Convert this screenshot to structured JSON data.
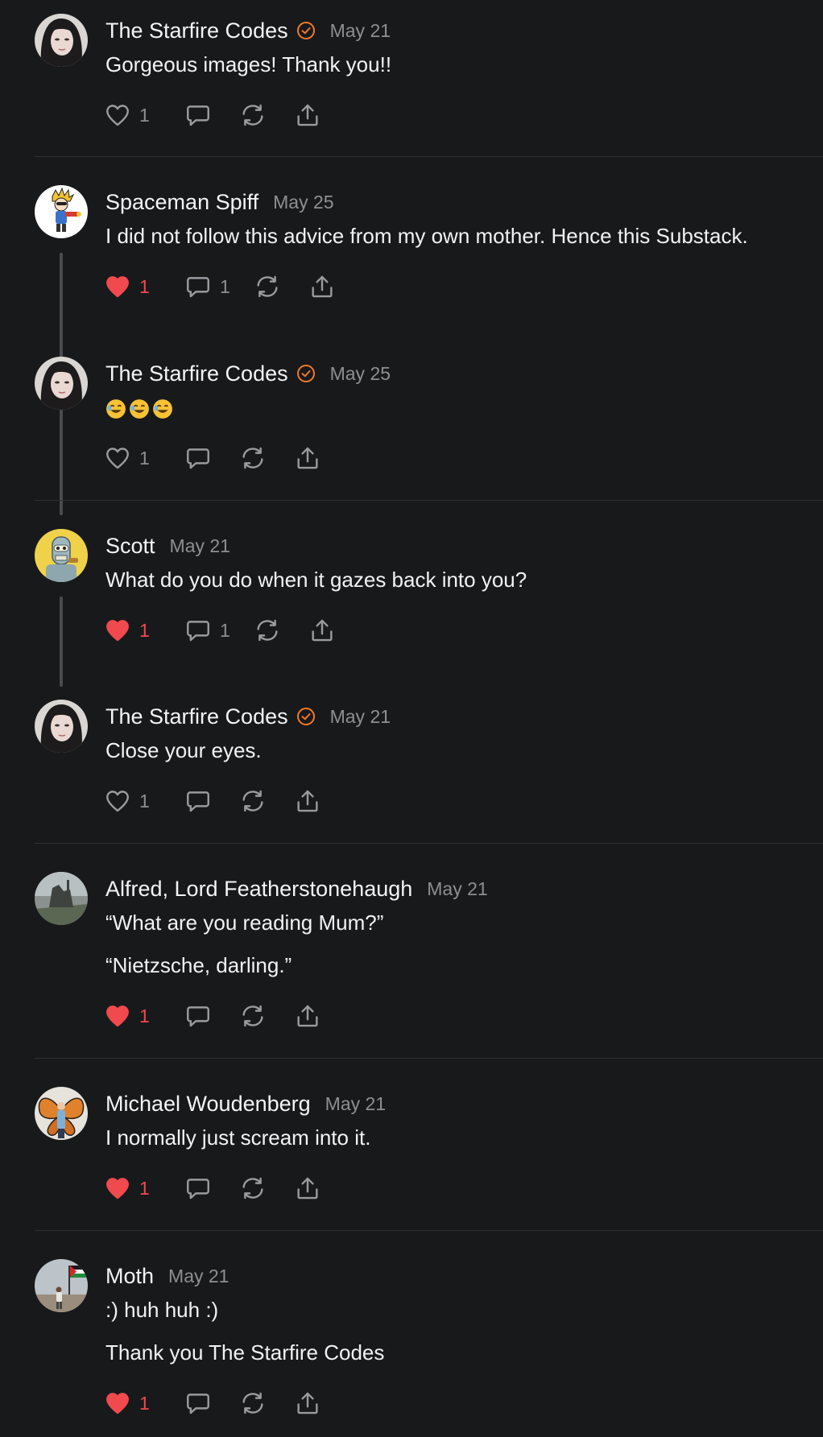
{
  "colors": {
    "background": "#18191b",
    "text": "#f2f2f2",
    "muted": "#8e8f93",
    "like_active": "#f0494e",
    "verified": "#f07a2a",
    "divider": "#2e2f32"
  },
  "icons": {
    "like": "heart-icon",
    "reply": "speech-bubble-icon",
    "restack": "restack-arrows-icon",
    "share": "share-upload-icon",
    "verified": "verified-check-badge-icon"
  },
  "comments": [
    {
      "author": "The Starfire Codes",
      "verified": true,
      "date": "May 21",
      "paragraphs": [
        "Gorgeous images! Thank you!!"
      ],
      "likes": "1",
      "liked": false,
      "replies": ""
    },
    {
      "author": "Spaceman Spiff",
      "verified": false,
      "date": "May 25",
      "paragraphs": [
        "I did not follow this advice from my own mother. Hence this Substack."
      ],
      "likes": "1",
      "liked": true,
      "replies": "1"
    },
    {
      "author": "The Starfire Codes",
      "verified": true,
      "date": "May 25",
      "paragraphs": [
        "🤣🤣🤣"
      ],
      "likes": "1",
      "liked": false,
      "replies": ""
    },
    {
      "author": "Scott",
      "verified": false,
      "date": "May 21",
      "paragraphs": [
        "What do you do when it gazes back into you?"
      ],
      "likes": "1",
      "liked": true,
      "replies": "1"
    },
    {
      "author": "The Starfire Codes",
      "verified": true,
      "date": "May 21",
      "paragraphs": [
        "Close your eyes."
      ],
      "likes": "1",
      "liked": false,
      "replies": ""
    },
    {
      "author": "Alfred, Lord Featherstonehaugh",
      "verified": false,
      "date": "May 21",
      "paragraphs": [
        "“What are you reading Mum?”",
        "“Nietzsche, darling.”"
      ],
      "likes": "1",
      "liked": true,
      "replies": ""
    },
    {
      "author": "Michael Woudenberg",
      "verified": false,
      "date": "May 21",
      "paragraphs": [
        "I normally just scream into it."
      ],
      "likes": "1",
      "liked": true,
      "replies": ""
    },
    {
      "author": "Moth",
      "verified": false,
      "date": "May 21",
      "paragraphs": [
        ":) huh huh :)",
        "Thank you The Starfire Codes"
      ],
      "likes": "1",
      "liked": true,
      "replies": ""
    }
  ]
}
